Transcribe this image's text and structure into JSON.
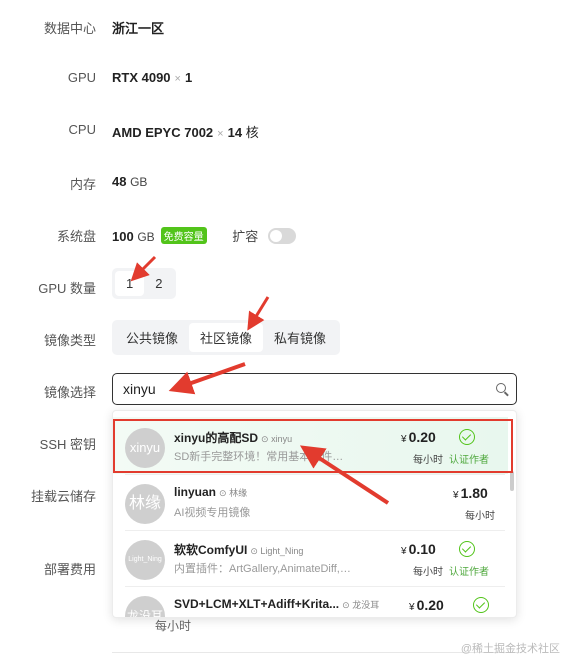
{
  "form": {
    "datacenter": {
      "label": "数据中心",
      "value": "浙江一区"
    },
    "gpu": {
      "label": "GPU",
      "model": "RTX 4090",
      "times": "×",
      "count": "1"
    },
    "cpu": {
      "label": "CPU",
      "model": "AMD EPYC 7002",
      "times": "×",
      "count": "14",
      "unit": "核"
    },
    "memory": {
      "label": "内存",
      "value": "48",
      "unit": "GB"
    },
    "disk": {
      "label": "系统盘",
      "value": "100",
      "unit": "GB",
      "badge": "免费容量",
      "expand_label": "扩容",
      "expand_on": false
    },
    "gpu_count": {
      "label": "GPU 数量",
      "options": [
        "1",
        "2"
      ],
      "selected": "1"
    },
    "image_type": {
      "label": "镜像类型",
      "options": [
        "公共镜像",
        "社区镜像",
        "私有镜像"
      ],
      "selected": "社区镜像"
    },
    "image_select": {
      "label": "镜像选择",
      "value": "xinyu"
    },
    "ssh": {
      "label": "SSH 密钥"
    },
    "storage": {
      "label": "挂载云储存"
    },
    "cost": {
      "label": "部署费用",
      "per_hour": "每小时"
    }
  },
  "dropdown": {
    "items": [
      {
        "avatar": "xinyu",
        "name": "xinyu的高配SD",
        "author": "xinyu",
        "desc": "SD新手完整环境！常用基本插件，C...",
        "currency": "¥",
        "price": "0.20",
        "per": "每小时",
        "verified": "认证作者"
      },
      {
        "avatar": "林缘",
        "name": "linyuan",
        "author": "林缘",
        "desc": "AI视频专用镜像",
        "currency": "¥",
        "price": "1.80",
        "per": "每小时",
        "verified": ""
      },
      {
        "avatar": "Light_Ning",
        "name": "软软ComfyUI",
        "author": "Light_Ning",
        "desc": "内置插件：ArtGallery,AnimateDiff,SV...",
        "currency": "¥",
        "price": "0.10",
        "per": "每小时",
        "verified": "认证作者"
      },
      {
        "avatar": "龙没耳",
        "name": "SVD+LCM+XLT+Adiff+Krita...",
        "author": "龙没耳",
        "desc": "",
        "currency": "¥",
        "price": "0.20",
        "per": "",
        "verified": ""
      }
    ]
  },
  "watermark": "@稀土掘金技术社区",
  "colors": {
    "accent": "#52c41a",
    "highlight": "#e23b2e",
    "segment_bg": "#f2f3f5"
  }
}
